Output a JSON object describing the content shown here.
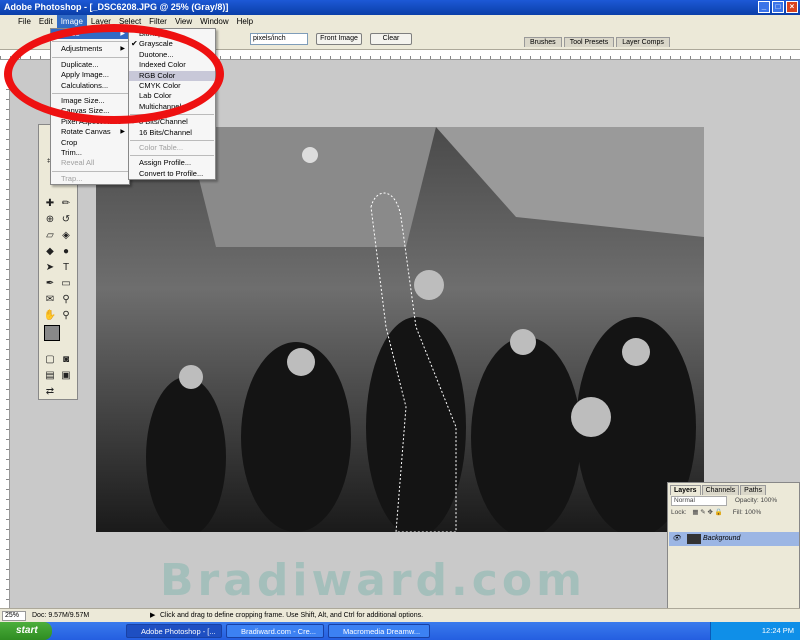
{
  "window": {
    "title": "Adobe Photoshop - [_DSC6208.JPG @ 25% (Gray/8)]",
    "controls": [
      "_",
      "□",
      "×"
    ]
  },
  "menubar": [
    "File",
    "Edit",
    "Image",
    "Layer",
    "Select",
    "Filter",
    "View",
    "Window",
    "Help"
  ],
  "options": {
    "resolution_unit": "pixels/inch",
    "front_image": "Front Image",
    "clear": "Clear"
  },
  "palette_tabs": [
    "Brushes",
    "Tool Presets",
    "Layer Comps"
  ],
  "image_menu": {
    "items": [
      "Mode",
      "Adjustments",
      "Duplicate...",
      "Apply Image...",
      "Calculations...",
      "Image Size...",
      "Canvas Size...",
      "Pixel Aspect Ratio",
      "Rotate Canvas",
      "Crop",
      "Trim...",
      "Reveal All",
      "Trap..."
    ]
  },
  "mode_menu": {
    "items": [
      "Bitmap...",
      "Grayscale",
      "Duotone...",
      "Indexed Color",
      "RGB Color",
      "CMYK Color",
      "Lab Color",
      "Multichannel",
      "8 Bits/Channel",
      "16 Bits/Channel",
      "Color Table...",
      "Assign Profile...",
      "Convert to Profile..."
    ]
  },
  "layers_panel": {
    "tabs": [
      "Layers",
      "Channels",
      "Paths"
    ],
    "blend_mode": "Normal",
    "opacity_label": "Opacity:",
    "opacity_value": "100%",
    "lock_label": "Lock:",
    "fill_label": "Fill:",
    "fill_value": "100%",
    "layer_name": "Background"
  },
  "watermark": "Bradiward.com",
  "statusbar": {
    "zoom": "25%",
    "doc": "Doc: 9.57M/9.57M",
    "hint": "Click and drag to define cropping frame. Use Shift, Alt, and Ctrl for additional options."
  },
  "taskbar": {
    "start": "start",
    "tasks": [
      "Adobe Photoshop - [...",
      "Bradiward.com - Cre...",
      "Macromedia Dreamw..."
    ],
    "clock": "12:24 PM"
  }
}
